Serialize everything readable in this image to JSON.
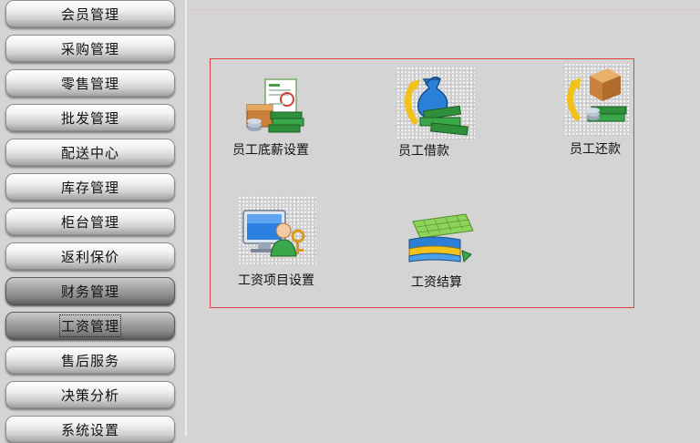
{
  "sidebar": {
    "items": [
      {
        "label": "会员管理",
        "style": "light"
      },
      {
        "label": "采购管理",
        "style": "light"
      },
      {
        "label": "零售管理",
        "style": "light"
      },
      {
        "label": "批发管理",
        "style": "light"
      },
      {
        "label": "配送中心",
        "style": "light"
      },
      {
        "label": "库存管理",
        "style": "light"
      },
      {
        "label": "柜台管理",
        "style": "light"
      },
      {
        "label": "返利保价",
        "style": "light"
      },
      {
        "label": "财务管理",
        "style": "dark"
      },
      {
        "label": "工资管理",
        "style": "dark",
        "selected": true
      },
      {
        "label": "售后服务",
        "style": "light"
      },
      {
        "label": "决策分析",
        "style": "light"
      },
      {
        "label": "系统设置",
        "style": "light"
      }
    ]
  },
  "panel": {
    "border_color": "#e04040",
    "tiles": [
      {
        "label": "员工底薪设置",
        "icon": "salary-document-money-icon"
      },
      {
        "label": "员工借款",
        "icon": "money-bag-loan-icon"
      },
      {
        "label": "员工还款",
        "icon": "box-repay-money-icon"
      },
      {
        "label": "工资项目设置",
        "icon": "monitor-user-key-icon"
      },
      {
        "label": "工资结算",
        "icon": "ledger-books-icon"
      }
    ]
  }
}
